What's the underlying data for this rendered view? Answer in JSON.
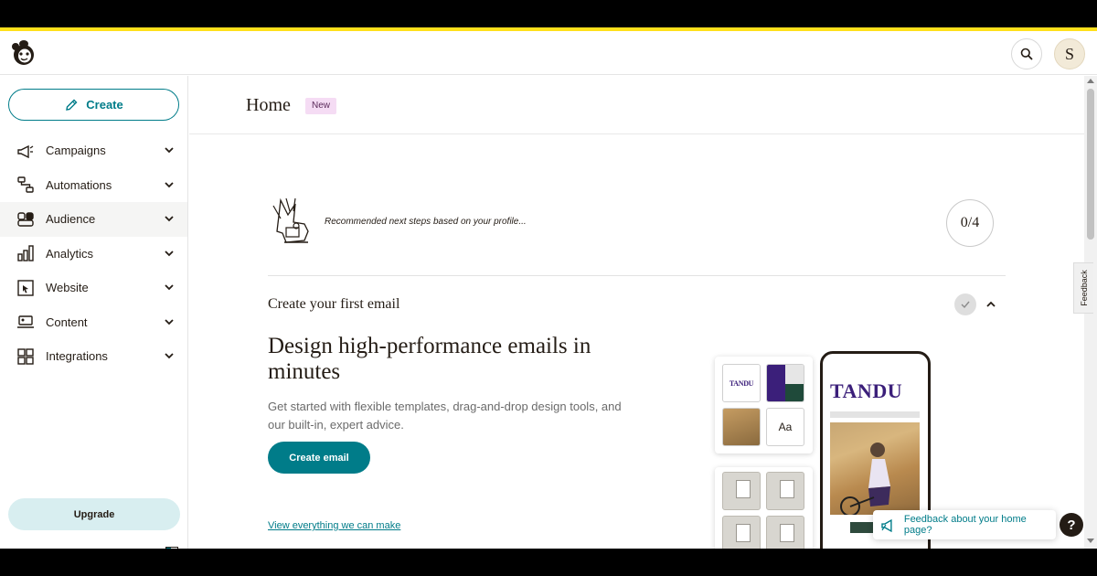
{
  "topbar": {
    "avatar_initial": "S"
  },
  "sidebar": {
    "create_label": "Create",
    "items": [
      {
        "label": "Campaigns",
        "icon": "megaphone-icon"
      },
      {
        "label": "Automations",
        "icon": "automation-icon"
      },
      {
        "label": "Audience",
        "icon": "audience-icon",
        "active": true
      },
      {
        "label": "Analytics",
        "icon": "bar-chart-icon"
      },
      {
        "label": "Website",
        "icon": "website-icon"
      },
      {
        "label": "Content",
        "icon": "content-icon"
      },
      {
        "label": "Integrations",
        "icon": "grid-icon"
      }
    ],
    "upgrade_label": "Upgrade"
  },
  "main": {
    "title": "Home",
    "badge": "New",
    "recommendation_text": "Recommended next steps based on your profile...",
    "progress": "0/4",
    "section_title": "Create your first email",
    "headline": "Design high-performance emails in minutes",
    "description": "Get started with flexible templates, drag-and-drop design tools, and our built-in, expert advice.",
    "create_email_label": "Create email",
    "view_link": "View everything we can make",
    "illustration": {
      "brand_small": "TANDU",
      "brand_phone": "TANDU",
      "font_tile": "Aa"
    }
  },
  "floaters": {
    "feedback_label": "Feedback about your home page?",
    "help_label": "?",
    "side_feedback": "Feedback"
  },
  "colors": {
    "accent": "#007c89",
    "brand_yellow": "#ffe01b",
    "badge_bg": "#f5dcf4"
  }
}
